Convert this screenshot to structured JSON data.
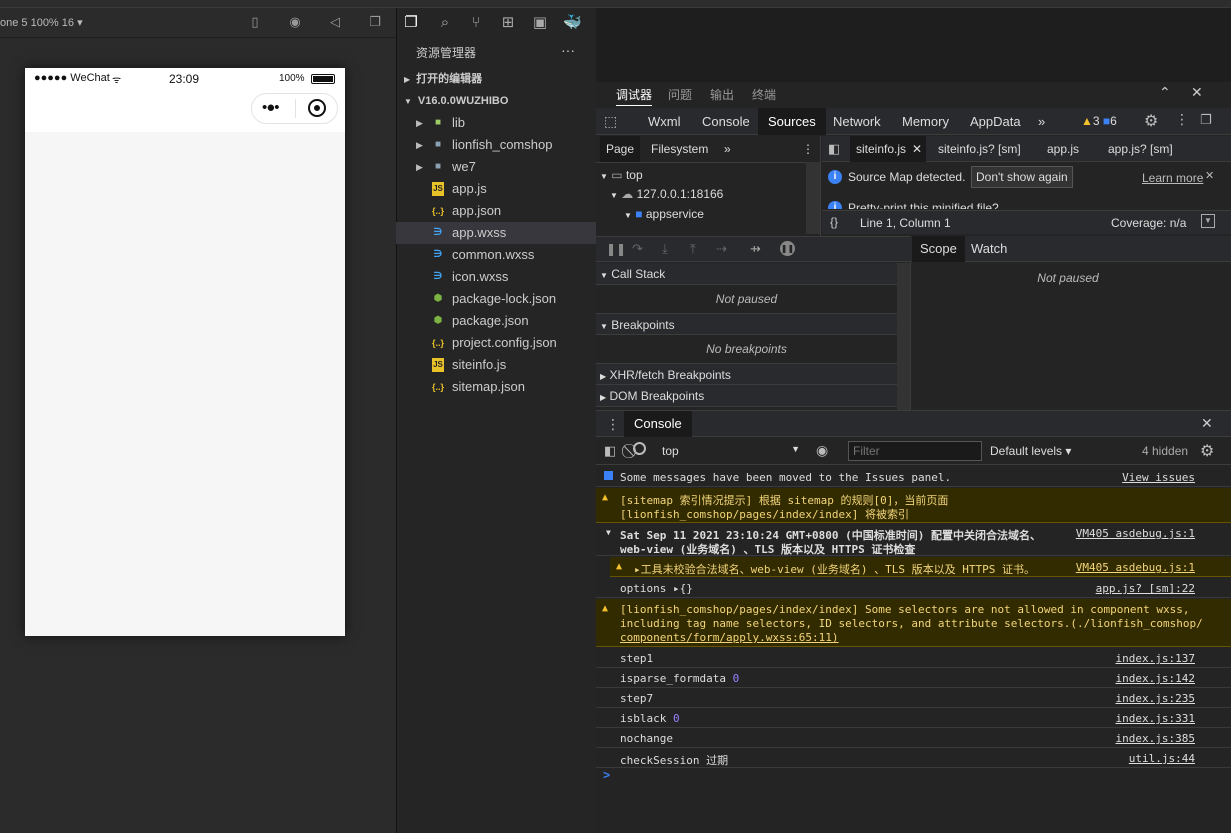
{
  "simulator": {
    "device_label": "one 5 100% 16 ▾",
    "status_carrier": "●●●●● WeChat",
    "status_time": "23:09",
    "status_battery": "100%"
  },
  "explorer": {
    "title": "资源管理器",
    "more": "···",
    "open_editors": "打开的编辑器",
    "project": "V16.0.0WUZHIBO",
    "items": [
      {
        "name": "lib",
        "type": "folder"
      },
      {
        "name": "lionfish_comshop",
        "type": "folder"
      },
      {
        "name": "we7",
        "type": "folder"
      },
      {
        "name": "app.js",
        "type": "js"
      },
      {
        "name": "app.json",
        "type": "json"
      },
      {
        "name": "app.wxss",
        "type": "wxss"
      },
      {
        "name": "common.wxss",
        "type": "wxss"
      },
      {
        "name": "icon.wxss",
        "type": "wxss"
      },
      {
        "name": "package-lock.json",
        "type": "npm"
      },
      {
        "name": "package.json",
        "type": "npm"
      },
      {
        "name": "project.config.json",
        "type": "json"
      },
      {
        "name": "siteinfo.js",
        "type": "js"
      },
      {
        "name": "sitemap.json",
        "type": "json"
      }
    ]
  },
  "devtools": {
    "top_tabs": [
      "调试器",
      "问题",
      "输出",
      "终端"
    ],
    "tabs": [
      "Wxml",
      "Console",
      "Sources",
      "Network",
      "Memory",
      "AppData"
    ],
    "more_tabs": "»",
    "warn_count": "3",
    "info_count": "6",
    "sources": {
      "nav_tabs": [
        "Page",
        "Filesystem"
      ],
      "file_tabs": [
        "siteinfo.js",
        "siteinfo.js? [sm]",
        "app.js",
        "app.js? [sm]"
      ],
      "tree": [
        "top",
        "127.0.0.1:18166",
        "appservice"
      ],
      "sourcemap_msg": "Source Map detected.",
      "dont_show": "Don't show again",
      "learn_more": "Learn more",
      "pretty_print": "Pretty-print this minified file?",
      "cursor_pos": "Line 1, Column 1",
      "coverage": "Coverage: n/a",
      "format_icon": "{}"
    },
    "debugger": {
      "call_stack": "Call Stack",
      "not_paused": "Not paused",
      "breakpoints": "Breakpoints",
      "no_breakpoints": "No breakpoints",
      "xhr": "XHR/fetch Breakpoints",
      "dom": "DOM Breakpoints",
      "scope": "Scope",
      "watch": "Watch",
      "scope_not_paused": "Not paused"
    },
    "console": {
      "title": "Console",
      "context": "top",
      "filter_placeholder": "Filter",
      "levels": "Default levels ▾",
      "hidden": "4 hidden",
      "messages": [
        {
          "kind": "info",
          "text": "Some messages have been moved to the Issues panel.",
          "src": "View issues"
        },
        {
          "kind": "warn",
          "text": "[sitemap 索引情况提示] 根据 sitemap 的规则[0]，当前页面",
          "text2": "[lionfish_comshop/pages/index/index] 将被索引",
          "src": ""
        },
        {
          "kind": "group",
          "text": "Sat Sep 11 2021 23:10:24 GMT+0800 (中国标准时间) 配置中关闭合法域名、",
          "text2": "web-view (业务域名) 、TLS 版本以及 HTTPS 证书检查",
          "src": "VM405 asdebug.js:1"
        },
        {
          "kind": "warn",
          "text": "▸工具未校验合法域名、web-view (业务域名) 、TLS 版本以及 HTTPS 证书。",
          "src": "VM405 asdebug.js:1"
        },
        {
          "kind": "log",
          "text": "options ▸{}",
          "src": "app.js? [sm]:22"
        },
        {
          "kind": "warn",
          "text": "[lionfish_comshop/pages/index/index] Some selectors are not allowed in component wxss,",
          "text2": "including tag name selectors, ID selectors, and attribute selectors.(./lionfish_comshop/",
          "text3": "components/form/apply.wxss:65:11)",
          "src": ""
        },
        {
          "kind": "log",
          "text": "step1",
          "src": "index.js:137"
        },
        {
          "kind": "log",
          "text": "isparse_formdata",
          "num": "0",
          "src": "index.js:142"
        },
        {
          "kind": "log",
          "text": "step7",
          "src": "index.js:235"
        },
        {
          "kind": "log",
          "text": "isblack",
          "num": "0",
          "src": "index.js:331"
        },
        {
          "kind": "log",
          "text": "nochange",
          "src": "index.js:385"
        },
        {
          "kind": "log",
          "text": "checkSession 过期",
          "src": "util.js:44"
        }
      ],
      "prompt": ">"
    }
  }
}
